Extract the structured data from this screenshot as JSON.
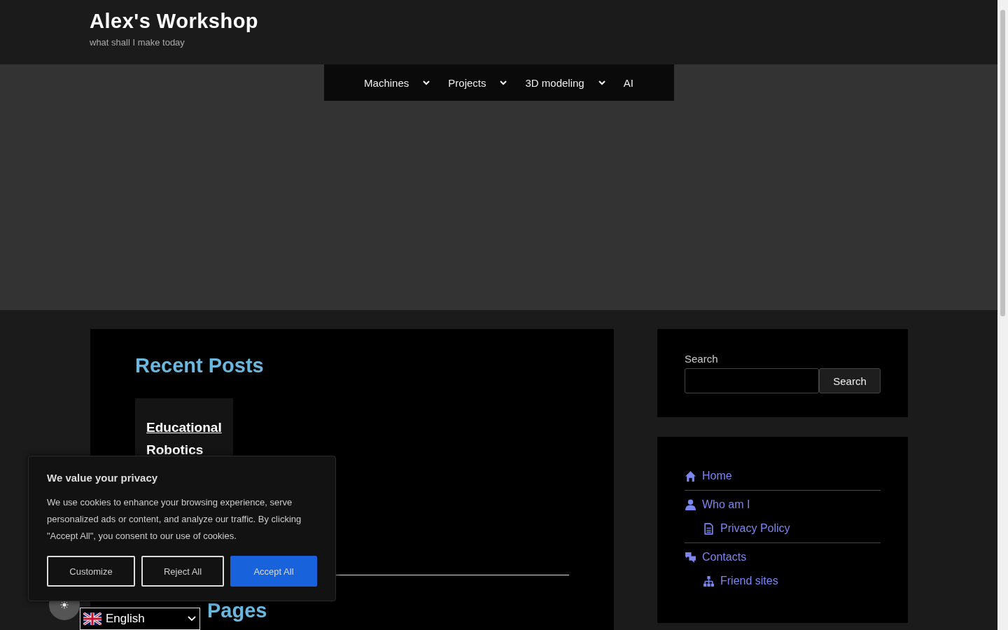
{
  "site": {
    "title": "Alex's Workshop",
    "tagline": "what shall I make today"
  },
  "nav": [
    {
      "label": "Machines",
      "has_submenu": true
    },
    {
      "label": "Projects",
      "has_submenu": true
    },
    {
      "label": "3D modeling",
      "has_submenu": true
    },
    {
      "label": "AI",
      "has_submenu": false
    }
  ],
  "main": {
    "recent_posts_heading": "Recent Posts",
    "posts": [
      {
        "title_line_1": "Educational",
        "title_line_2": "Robotics"
      }
    ],
    "recent_pages_heading_visible": "Pages"
  },
  "sidebar": {
    "search": {
      "label": "Search",
      "button": "Search"
    },
    "pages": [
      {
        "label": "Home"
      },
      {
        "label": "Who am I",
        "children": [
          {
            "label": "Privacy Policy"
          }
        ]
      },
      {
        "label": "Contacts",
        "children": [
          {
            "label": "Friend sites"
          }
        ]
      }
    ]
  },
  "cookie_banner": {
    "title": "We value your privacy",
    "text": "We use cookies to enhance your browsing experience, serve personalized ads or content, and analyze our traffic. By clicking \"Accept All\", you consent to our use of cookies.",
    "buttons": [
      {
        "label": "Customize",
        "kind": "outline"
      },
      {
        "label": "Reject All",
        "kind": "outline"
      },
      {
        "label": "Accept All",
        "kind": "primary"
      }
    ]
  },
  "language": {
    "label": "English"
  }
}
